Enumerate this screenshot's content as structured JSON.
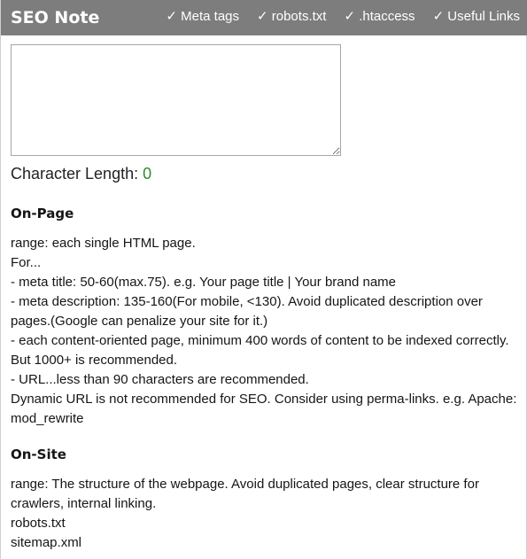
{
  "header": {
    "brand": "SEO Note",
    "nav": [
      {
        "label": "✓ Meta tags"
      },
      {
        "label": "✓ robots.txt"
      },
      {
        "label": "✓ .htaccess"
      },
      {
        "label": "✓ Useful Links"
      }
    ]
  },
  "editor": {
    "value": "",
    "char_length_label": "Character Length: ",
    "char_length_value": "0"
  },
  "sections": {
    "onpage": {
      "title": "On-Page",
      "lines": [
        "range: each single HTML page.",
        "For...",
        "- meta title: 50-60(max.75). e.g. Your page title | Your brand name",
        "- meta description: 135-160(For mobile, <130). Avoid duplicated description over pages.(Google can penalize your site for it.)",
        "- each content-oriented page, minimum 400 words of content to be indexed correctly. But 1000+ is recommended.",
        "- URL...less than 90 characters are recommended.",
        "Dynamic URL is not recommended for SEO. Consider using perma-links. e.g. Apache: mod_rewrite"
      ]
    },
    "onsite": {
      "title": "On-Site",
      "lines": [
        "range: The structure of the webpage. Avoid duplicated pages, clear structure for crawlers, internal linking.",
        "robots.txt",
        "sitemap.xml"
      ]
    }
  }
}
